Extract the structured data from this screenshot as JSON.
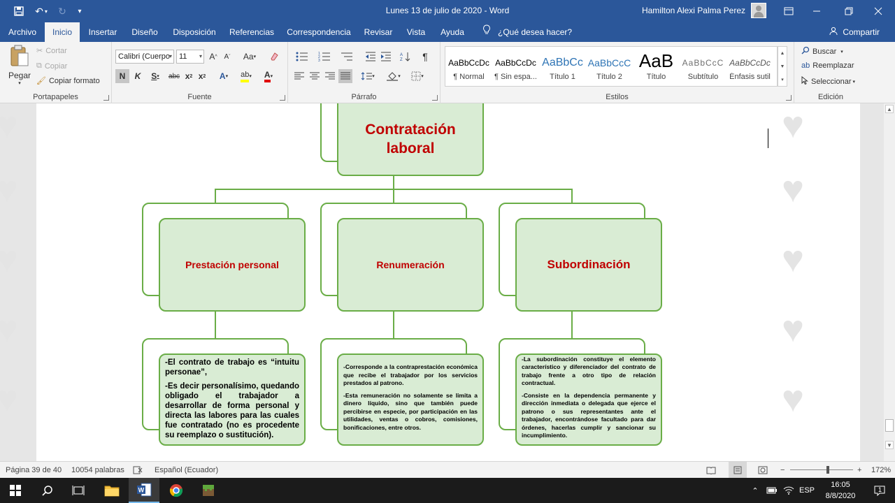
{
  "titlebar": {
    "title": "Lunes 13 de julio de 2020  -  Word",
    "user": "Hamilton Alexi Palma Perez"
  },
  "tabs": [
    "Archivo",
    "Inicio",
    "Insertar",
    "Diseño",
    "Disposición",
    "Referencias",
    "Correspondencia",
    "Revisar",
    "Vista",
    "Ayuda"
  ],
  "active_tab": "Inicio",
  "tell_me": "¿Qué desea hacer?",
  "share": "Compartir",
  "clipboard": {
    "paste": "Pegar",
    "cut": "Cortar",
    "copy": "Copiar",
    "format_painter": "Copiar formato",
    "label": "Portapapeles"
  },
  "font": {
    "name": "Calibri (Cuerpo",
    "size": "11",
    "label": "Fuente"
  },
  "paragraph": {
    "label": "Párrafo"
  },
  "styles": {
    "label": "Estilos",
    "items": [
      {
        "sample": "AaBbCcDc",
        "name": "¶ Normal"
      },
      {
        "sample": "AaBbCcDc",
        "name": "¶ Sin espa..."
      },
      {
        "sample": "AaBbCc",
        "name": "Título 1"
      },
      {
        "sample": "AaBbCcC",
        "name": "Título 2"
      },
      {
        "sample": "AaB",
        "name": "Título"
      },
      {
        "sample": "AaBbCcC",
        "name": "Subtítulo"
      },
      {
        "sample": "AaBbCcDc",
        "name": "Énfasis sutil"
      }
    ]
  },
  "editing": {
    "find": "Buscar",
    "replace": "Reemplazar",
    "select": "Seleccionar",
    "label": "Edición"
  },
  "diagram": {
    "root": "Contratación laboral",
    "branches": [
      {
        "title": "Prestación personal",
        "paragraphs": [
          "-El contrato de trabajo es “intuitu personae”,",
          "-Es decir personalísimo, quedando obligado el trabajador a desarrollar de forma personal y directa las labores para las cuales fue contratado (no es procedente su reemplazo o sustitución)."
        ]
      },
      {
        "title": "Renumeración",
        "paragraphs": [
          "-Corresponde a la contraprestación económica que recibe el trabajador por los servicios prestados al patrono.",
          "-Esta remuneración no solamente se limita a dinero líquido, sino que también puede percibirse en especie, por participación en las utilidades, ventas o cobros, comisiones, bonificaciones, entre otros."
        ]
      },
      {
        "title": "Subordinación",
        "paragraphs": [
          "-La subordinación constituye el elemento característico y diferenciador del contrato de trabajo frente a otro tipo de relación contractual.",
          "-Consiste en la dependencia permanente y dirección inmediata o delegada que ejerce el patrono o sus representantes ante el trabajador, encontrándose facultado para dar órdenes, hacerlas cumplir y sancionar su incumplimiento."
        ]
      }
    ]
  },
  "statusbar": {
    "page": "Página 39 de 40",
    "words": "10054 palabras",
    "language": "Español (Ecuador)",
    "zoom": "172%"
  },
  "taskbar": {
    "language": "ESP",
    "time": "16:05",
    "date": "8/8/2020",
    "notifications": "1"
  },
  "colors": {
    "word_blue": "#2b579a",
    "box_fill": "#d9ecd4",
    "box_border": "#6aad47",
    "title_red": "#c00000"
  }
}
